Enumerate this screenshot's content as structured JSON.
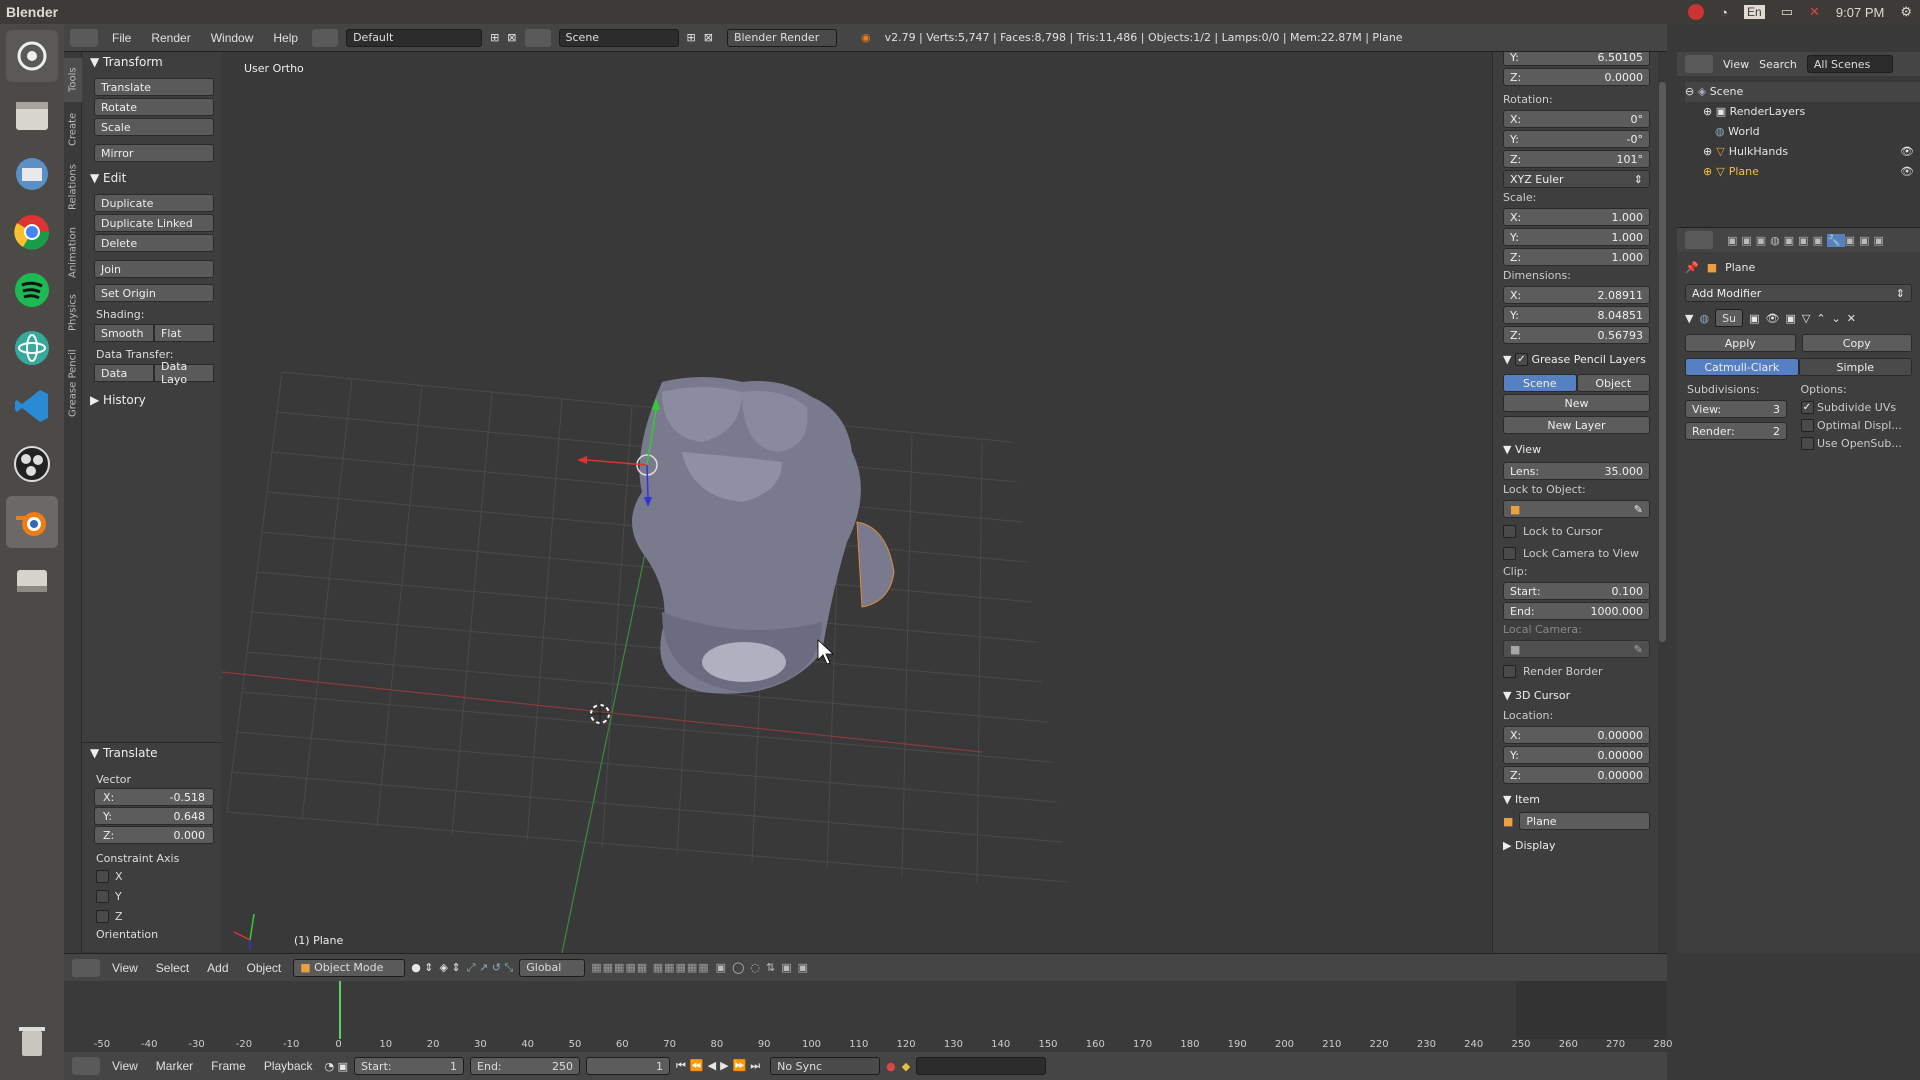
{
  "window": {
    "app_title": "Blender"
  },
  "tray": {
    "lang": "En",
    "time": "9:07 PM"
  },
  "info": {
    "menus": [
      "File",
      "Render",
      "Window",
      "Help"
    ],
    "layout": "Default",
    "scene": "Scene",
    "engine": "Blender Render",
    "stats": "v2.79 | Verts:5,747 | Faces:8,798 | Tris:11,486 | Objects:1/2 | Lamps:0/0 | Mem:22.87M | Plane"
  },
  "tooltabs": [
    "Tools",
    "Create",
    "Relations",
    "Animation",
    "Physics",
    "Grease Pencil"
  ],
  "toolshelf": {
    "transform_header": "Transform",
    "translate": "Translate",
    "rotate": "Rotate",
    "scale": "Scale",
    "mirror": "Mirror",
    "edit_header": "Edit",
    "duplicate": "Duplicate",
    "duplicate_linked": "Duplicate Linked",
    "delete": "Delete",
    "join": "Join",
    "set_origin": "Set Origin",
    "shading_label": "Shading:",
    "smooth": "Smooth",
    "flat": "Flat",
    "data_transfer_label": "Data Transfer:",
    "data": "Data",
    "data_layo": "Data Layo",
    "history_header": "History"
  },
  "redo": {
    "header": "Translate",
    "vector_label": "Vector",
    "x_label": "X:",
    "x": "-0.518",
    "y_label": "Y:",
    "y": "0.648",
    "z_label": "Z:",
    "z": "0.000",
    "constraint_label": "Constraint Axis",
    "cx": "X",
    "cy": "Y",
    "cz": "Z",
    "orientation_label": "Orientation"
  },
  "viewport": {
    "view_label": "User Ortho",
    "object_label": "(1) Plane"
  },
  "vhdr": {
    "view": "View",
    "select": "Select",
    "add": "Add",
    "object": "Object",
    "mode": "Object Mode",
    "orientation": "Global"
  },
  "timeline": {
    "ticks": [
      "-50",
      "-40",
      "-30",
      "-20",
      "-10",
      "0",
      "10",
      "20",
      "30",
      "40",
      "50",
      "60",
      "70",
      "80",
      "90",
      "100",
      "110",
      "120",
      "130",
      "140",
      "150",
      "160",
      "170",
      "180",
      "190",
      "200",
      "210",
      "220",
      "230",
      "240",
      "250",
      "260",
      "270",
      "280"
    ]
  },
  "tlhdr": {
    "view": "View",
    "marker": "Marker",
    "frame": "Frame",
    "playback": "Playback",
    "start_label": "Start:",
    "start": "1",
    "end_label": "End:",
    "end": "250",
    "current": "1",
    "sync": "No Sync"
  },
  "npanel": {
    "loc_y": "6.50105",
    "loc_z_label": "Z:",
    "loc_z": "0.0000",
    "rotation_label": "Rotation:",
    "rot_x": "0°",
    "rot_y": "-0°",
    "rot_z": "101°",
    "rot_mode": "XYZ Euler",
    "scale_label": "Scale:",
    "sc_x": "1.000",
    "sc_y": "1.000",
    "sc_z": "1.000",
    "dimensions_label": "Dimensions:",
    "dim_x": "2.08911",
    "dim_y": "8.04851",
    "dim_z": "0.56793",
    "gp_header": "Grease Pencil Layers",
    "gp_scene": "Scene",
    "gp_object": "Object",
    "gp_new": "New",
    "gp_new_layer": "New Layer",
    "view_header": "View",
    "lens_label": "Lens:",
    "lens": "35.000",
    "lock_obj_label": "Lock to Object:",
    "lock_cursor": "Lock to Cursor",
    "lock_camera": "Lock Camera to View",
    "clip_label": "Clip:",
    "clip_start_label": "Start:",
    "clip_start": "0.100",
    "clip_end_label": "End:",
    "clip_end": "1000.000",
    "local_camera": "Local Camera:",
    "render_border": "Render Border",
    "cursor_header": "3D Cursor",
    "location_label": "Location:",
    "cur_x": "0.00000",
    "cur_y": "0.00000",
    "cur_z": "0.00000",
    "item_header": "Item",
    "item_name": "Plane",
    "display_header": "Display",
    "x": "X:",
    "y": "Y:",
    "z": "Z:"
  },
  "outliner": {
    "view": "View",
    "search": "Search",
    "filter": "All Scenes",
    "items": [
      "Scene",
      "RenderLayers",
      "World",
      "HulkHands",
      "Plane"
    ]
  },
  "props": {
    "object": "Plane",
    "add_modifier": "Add Modifier",
    "mod_name": "Su",
    "apply": "Apply",
    "copy": "Copy",
    "catmull": "Catmull-Clark",
    "simple": "Simple",
    "subdivisions": "Subdivisions:",
    "options": "Options:",
    "view_label": "View:",
    "view_val": "3",
    "render_label": "Render:",
    "render_val": "2",
    "subdivide_uvs": "Subdivide UVs",
    "optimal": "Optimal Displ...",
    "opensubdiv": "Use OpenSub..."
  }
}
